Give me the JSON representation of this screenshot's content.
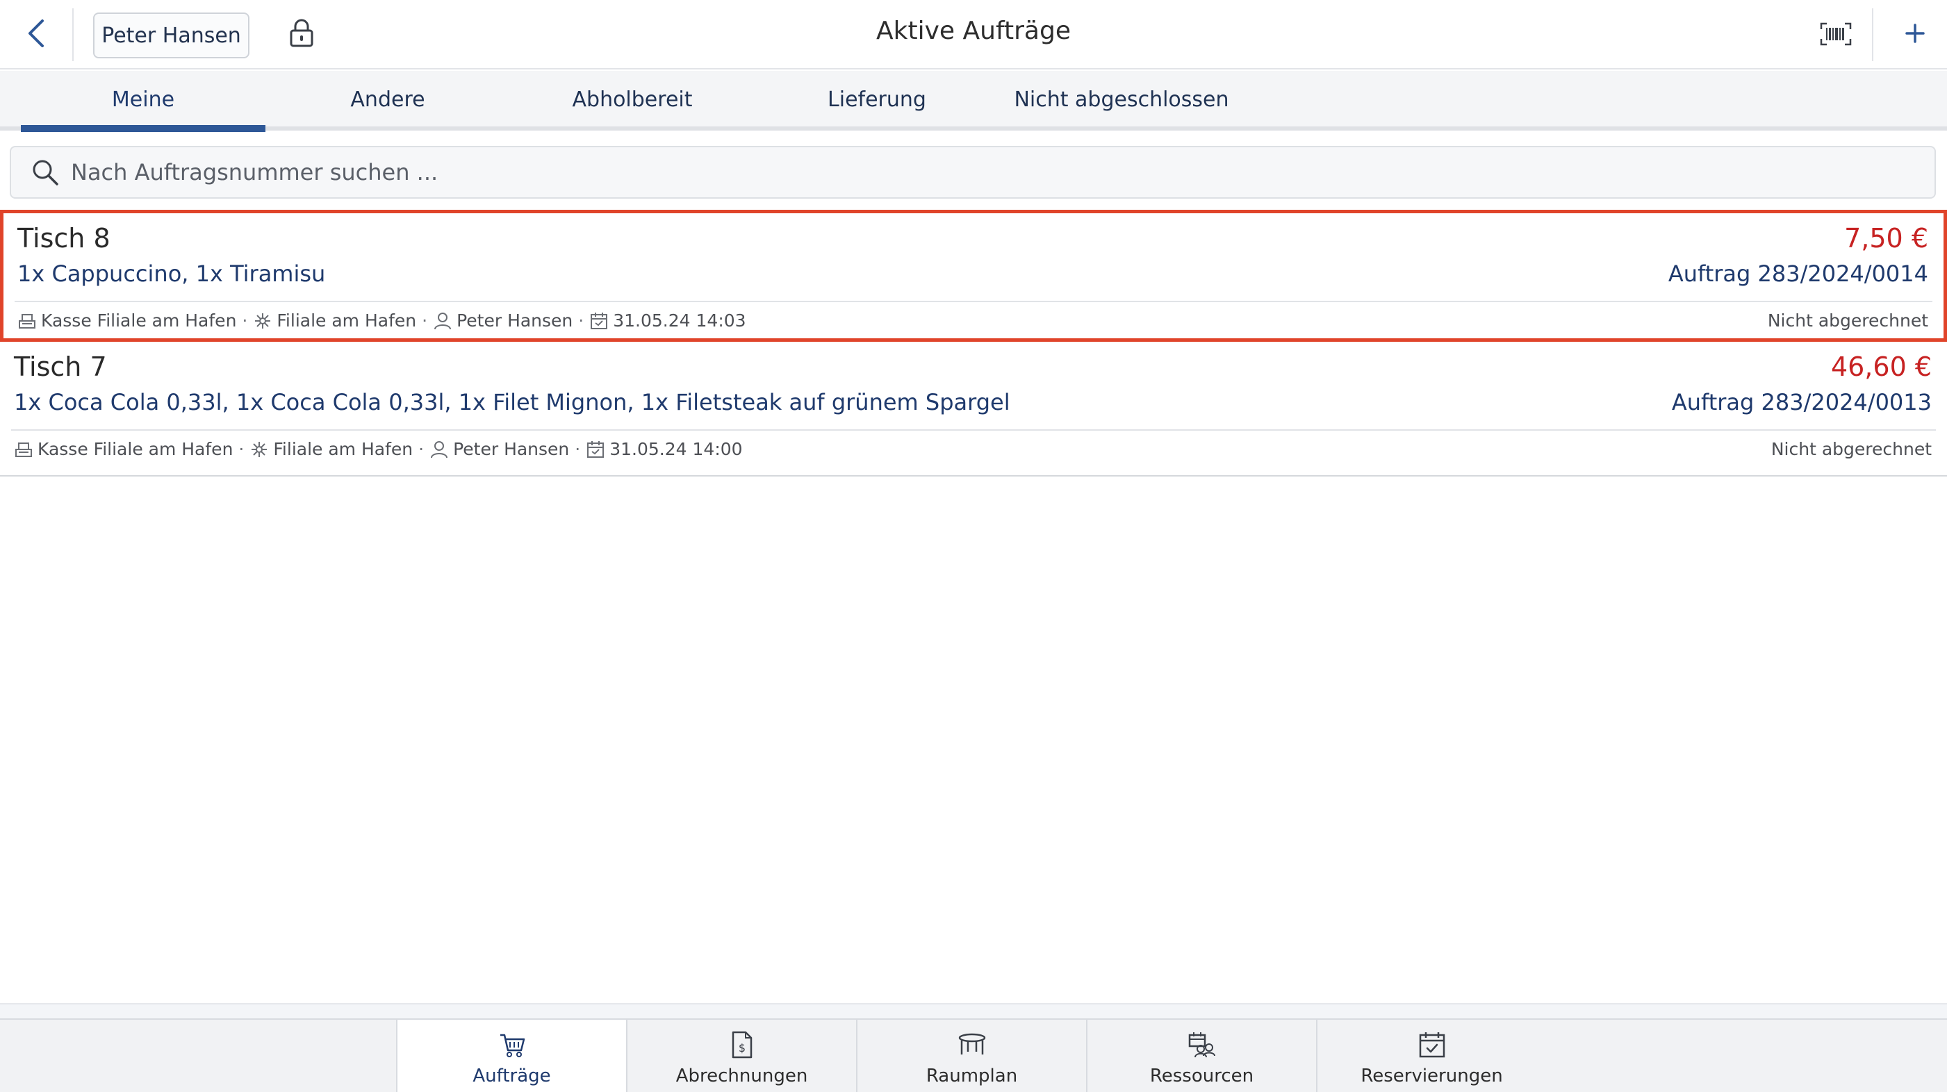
{
  "header": {
    "title": "Aktive Aufträge",
    "user_label": "Peter Hansen",
    "icons": [
      "chevron-left-icon",
      "lock-icon",
      "barcode-icon",
      "plus-icon"
    ]
  },
  "tabs": [
    {
      "label": "Meine",
      "active": true
    },
    {
      "label": "Andere",
      "active": false
    },
    {
      "label": "Abholbereit",
      "active": false
    },
    {
      "label": "Lieferung",
      "active": false
    },
    {
      "label": "Nicht abgeschlossen",
      "active": false
    }
  ],
  "search": {
    "placeholder": "Nach Auftragsnummer suchen ...",
    "value": ""
  },
  "orders": [
    {
      "table": "Tisch 8",
      "price": "7,50 €",
      "items": "1x Cappuccino, 1x Tiramisu",
      "order_number": "Auftrag 283/2024/0014",
      "register": "Kasse Filiale am Hafen",
      "branch": "Filiale am Hafen",
      "waiter": "Peter Hansen",
      "datetime": "31.05.24 14:03",
      "status": "Nicht abgerechnet",
      "selected": true
    },
    {
      "table": "Tisch 7",
      "price": "46,60 €",
      "items": "1x Coca Cola 0,33l, 1x Coca Cola 0,33l, 1x Filet Mignon, 1x Filetsteak auf grünem Spargel",
      "order_number": "Auftrag 283/2024/0013",
      "register": "Kasse Filiale am Hafen",
      "branch": "Filiale am Hafen",
      "waiter": "Peter Hansen",
      "datetime": "31.05.24 14:00",
      "status": "Nicht abgerechnet",
      "selected": false
    }
  ],
  "bottom_nav": [
    {
      "label": "Aufträge",
      "icon": "basket-icon",
      "active": true
    },
    {
      "label": "Abrechnungen",
      "icon": "invoice-icon",
      "active": false
    },
    {
      "label": "Raumplan",
      "icon": "table-icon",
      "active": false
    },
    {
      "label": "Ressourcen",
      "icon": "resources-icon",
      "active": false
    },
    {
      "label": "Reservierungen",
      "icon": "calendar-check-icon",
      "active": false
    }
  ],
  "colors": {
    "accent": "#2d5797",
    "price": "#c72222",
    "selection_border": "#e0442a",
    "link_text": "#1f3a6d"
  }
}
